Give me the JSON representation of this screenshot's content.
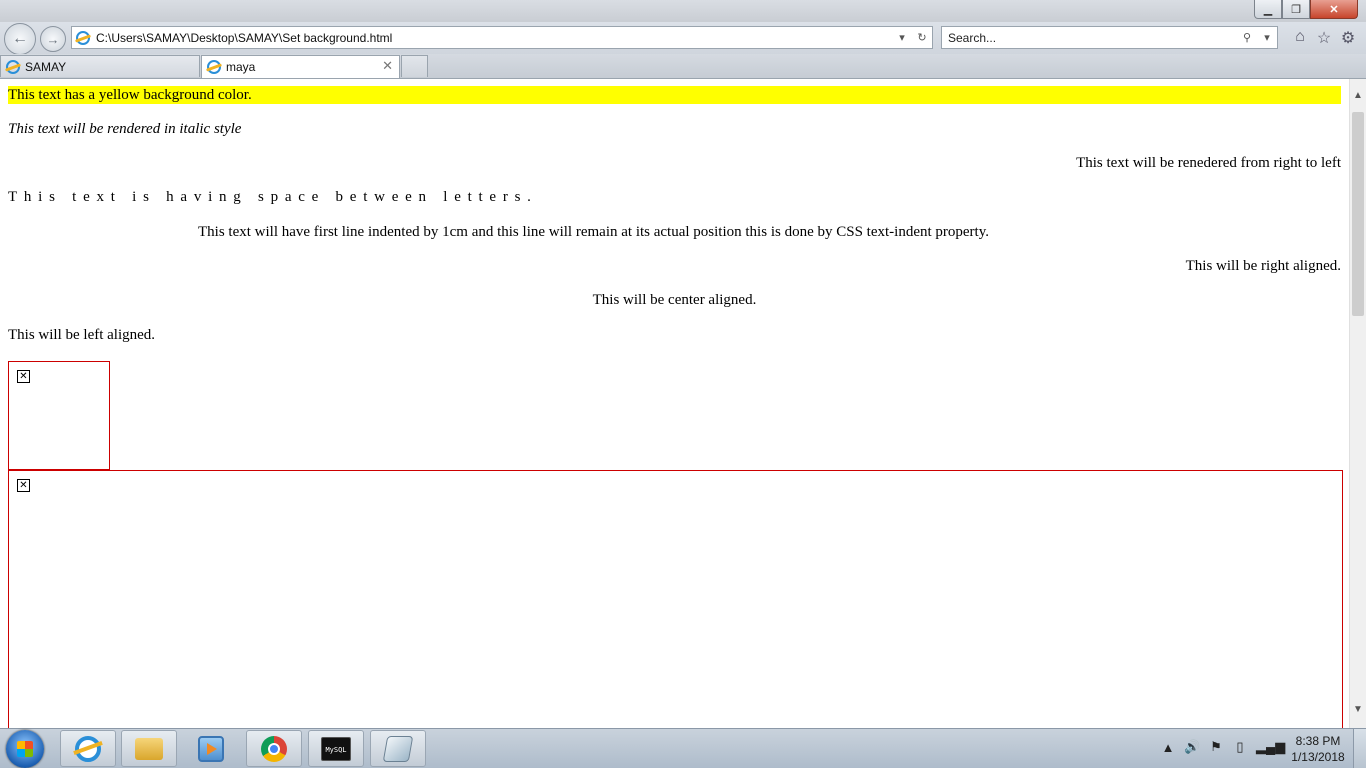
{
  "window": {
    "minimize_icon": "minimize-icon",
    "restore_icon": "restore-icon",
    "close_icon": "close-icon"
  },
  "navbar": {
    "address": "C:\\Users\\SAMAY\\Desktop\\SAMAY\\Set background.html",
    "search_placeholder": "Search...",
    "icons": [
      "back-icon",
      "forward-icon",
      "dropdown-icon",
      "refresh-icon",
      "search-icon",
      "home-icon",
      "favorites-star-icon",
      "gear-icon"
    ]
  },
  "tabs": [
    {
      "label": "SAMAY",
      "active": false
    },
    {
      "label": "maya",
      "active": true
    }
  ],
  "page": {
    "yellow_text": "This text has a yellow background color.",
    "italic_text": "This text will be rendered in italic style",
    "rtl_text": "This text will be renedered from right to left",
    "spaced_text": "This text is having space between letters.",
    "indent_text": "This text will have first line indented by 1cm and this line will remain at its actual position this is done by CSS text-indent property.",
    "right_text": "This will be right aligned.",
    "center_text": "This will be center aligned.",
    "left_text": "This will be left aligned.",
    "broken_image_glyph": "✕",
    "colors": {
      "highlight": "#ffff00",
      "image_border": "#cc0000"
    }
  },
  "taskbar": {
    "apps": [
      "internet-explorer",
      "file-explorer",
      "media-player",
      "chrome",
      "mysql-console",
      "notepad-app"
    ],
    "mysql_label": "MySQL",
    "tray_icons": [
      "show-hidden-icons-arrow",
      "volume-icon",
      "action-center-flag-icon",
      "battery-icon",
      "network-signal-icon"
    ],
    "time": "8:38 PM",
    "date": "1/13/2018"
  }
}
